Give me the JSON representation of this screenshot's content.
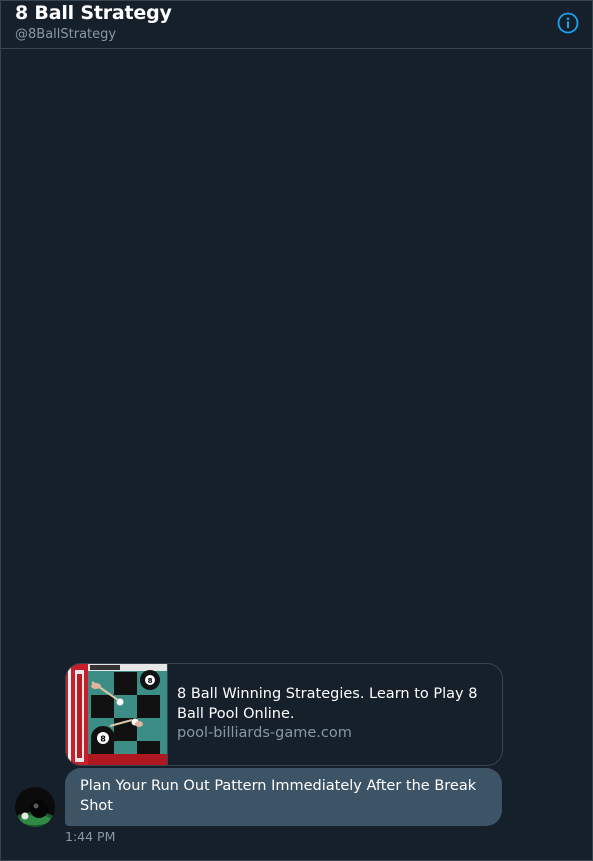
{
  "header": {
    "title": "8 Ball Strategy",
    "handle": "@8BallStrategy",
    "info_icon": "info-circle-icon"
  },
  "link_card": {
    "thumbnail_icon": "billiards-game-thumbnail",
    "title": "8 Ball Winning Strategies. Learn to Play 8 Ball Pool Online.",
    "domain": "pool-billiards-game.com"
  },
  "message": {
    "avatar_icon": "eight-ball-avatar",
    "text": "Plan Your Run Out Pattern Immediately After the Break Shot",
    "timestamp": "1:44 PM"
  },
  "colors": {
    "background": "#15202b",
    "border": "#38444d",
    "accent": "#1da1f2",
    "bubble": "#3d5466",
    "secondary_text": "#8899a6"
  }
}
